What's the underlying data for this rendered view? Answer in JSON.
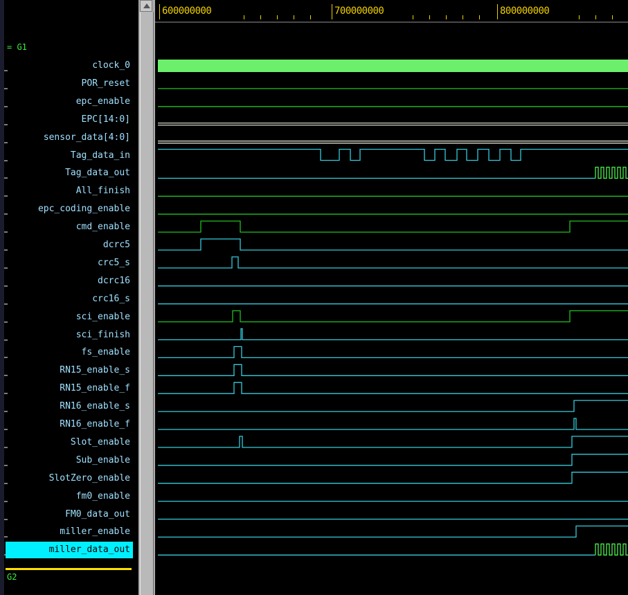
{
  "groups": {
    "g1": "= G1",
    "g2": "G2"
  },
  "signals": [
    {
      "name": "clock_0",
      "color": "#6cf06c",
      "kind": "clock"
    },
    {
      "name": "POR_reset",
      "color": "#1fbf1f",
      "kind": "low"
    },
    {
      "name": "epc_enable",
      "color": "#1fbf1f",
      "kind": "low"
    },
    {
      "name": "EPC[14:0]",
      "color": "#f0f0e0",
      "kind": "bus"
    },
    {
      "name": "sensor_data[4:0]",
      "color": "#f0f0e0",
      "kind": "bus"
    },
    {
      "name": "Tag_data_in",
      "color": "#33ccdd",
      "kind": "wave",
      "edges": [
        [
          0,
          "H"
        ],
        [
          235,
          "L"
        ],
        [
          262,
          "H"
        ],
        [
          278,
          "L"
        ],
        [
          292,
          "H"
        ],
        [
          385,
          "L"
        ],
        [
          400,
          "H"
        ],
        [
          415,
          "L"
        ],
        [
          432,
          "H"
        ],
        [
          446,
          "L"
        ],
        [
          462,
          "H"
        ],
        [
          478,
          "L"
        ],
        [
          494,
          "H"
        ],
        [
          510,
          "L"
        ],
        [
          524,
          "H"
        ]
      ]
    },
    {
      "name": "Tag_data_out",
      "color": "#33ccdd",
      "kind": "wave",
      "tail": "pulse",
      "tailColor": "#4cf04c",
      "edges": [
        [
          0,
          "L"
        ]
      ]
    },
    {
      "name": "All_finish",
      "color": "#1fbf1f",
      "kind": "low"
    },
    {
      "name": "epc_coding_enable",
      "color": "#1fbf1f",
      "kind": "low"
    },
    {
      "name": "cmd_enable",
      "color": "#1fbf1f",
      "kind": "wave",
      "edges": [
        [
          0,
          "L"
        ],
        [
          62,
          "H"
        ],
        [
          119,
          "L"
        ],
        [
          595,
          "H"
        ]
      ]
    },
    {
      "name": "dcrc5",
      "color": "#33ccdd",
      "kind": "wave",
      "edges": [
        [
          0,
          "L"
        ],
        [
          62,
          "H"
        ],
        [
          119,
          "L"
        ]
      ]
    },
    {
      "name": "crc5_s",
      "color": "#33ccdd",
      "kind": "wave",
      "mixed": true,
      "edges": [
        [
          0,
          "L"
        ],
        [
          107,
          "H"
        ],
        [
          116,
          "L"
        ]
      ]
    },
    {
      "name": "dcrc16",
      "color": "#33ccdd",
      "kind": "low"
    },
    {
      "name": "crc16_s",
      "color": "#33ccdd",
      "kind": "low"
    },
    {
      "name": "sci_enable",
      "color": "#1fbf1f",
      "kind": "wave",
      "mixed": true,
      "edges": [
        [
          0,
          "L"
        ],
        [
          108,
          "H"
        ],
        [
          119,
          "L"
        ],
        [
          595,
          "H"
        ]
      ]
    },
    {
      "name": "sci_finish",
      "color": "#33ccdd",
      "kind": "wave",
      "edges": [
        [
          0,
          "L"
        ],
        [
          120,
          "H"
        ],
        [
          122,
          "L"
        ]
      ]
    },
    {
      "name": "fs_enable",
      "color": "#33ccdd",
      "kind": "wave",
      "edges": [
        [
          0,
          "L"
        ],
        [
          110,
          "H"
        ],
        [
          121,
          "L"
        ]
      ]
    },
    {
      "name": "RN15_enable_s",
      "color": "#33ccdd",
      "kind": "wave",
      "edges": [
        [
          0,
          "L"
        ],
        [
          110,
          "H"
        ],
        [
          121,
          "L"
        ]
      ]
    },
    {
      "name": "RN15_enable_f",
      "color": "#33ccdd",
      "kind": "wave",
      "edges": [
        [
          0,
          "L"
        ],
        [
          110,
          "H"
        ],
        [
          121,
          "L"
        ]
      ]
    },
    {
      "name": "RN16_enable_s",
      "color": "#33ccdd",
      "kind": "wave",
      "edges": [
        [
          0,
          "L"
        ],
        [
          601,
          "H"
        ]
      ]
    },
    {
      "name": "RN16_enable_f",
      "color": "#33ccdd",
      "kind": "wave",
      "edges": [
        [
          0,
          "L"
        ],
        [
          601,
          "H"
        ],
        [
          604,
          "L"
        ]
      ]
    },
    {
      "name": "Slot_enable",
      "color": "#33ccdd",
      "kind": "wave",
      "edges": [
        [
          0,
          "L"
        ],
        [
          118,
          "H"
        ],
        [
          122,
          "L"
        ],
        [
          598,
          "H"
        ]
      ]
    },
    {
      "name": "Sub_enable",
      "color": "#33ccdd",
      "kind": "wave",
      "edges": [
        [
          0,
          "L"
        ],
        [
          598,
          "H"
        ]
      ]
    },
    {
      "name": "SlotZero_enable",
      "color": "#33ccdd",
      "kind": "wave",
      "edges": [
        [
          0,
          "L"
        ],
        [
          598,
          "H"
        ]
      ]
    },
    {
      "name": "fm0_enable",
      "color": "#33ccdd",
      "kind": "low"
    },
    {
      "name": "FM0_data_out",
      "color": "#33ccdd",
      "kind": "low"
    },
    {
      "name": "miller_enable",
      "color": "#33ccdd",
      "kind": "wave",
      "edges": [
        [
          0,
          "L"
        ],
        [
          604,
          "H"
        ]
      ]
    },
    {
      "name": "miller_data_out",
      "color": "#33ccdd",
      "kind": "wave",
      "tail": "pulse",
      "tailColor": "#4cf04c",
      "edges": [
        [
          0,
          "L"
        ]
      ],
      "selected": true
    }
  ],
  "ruler": {
    "labels": [
      "600000000",
      "700000000",
      "800000000"
    ]
  }
}
